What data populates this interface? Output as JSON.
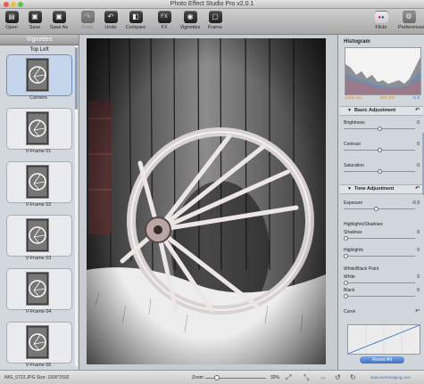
{
  "window": {
    "title": "Photo Effect Studio Pro v2.0.1"
  },
  "toolbar": {
    "items": [
      {
        "label": "Open",
        "glyph": "▤"
      },
      {
        "label": "Save",
        "glyph": "▣"
      },
      {
        "label": "Save As",
        "glyph": "▣"
      },
      {
        "label": "Redo",
        "glyph": "↷"
      },
      {
        "label": "Undo",
        "glyph": "↶"
      },
      {
        "label": "Compare",
        "glyph": "◧"
      },
      {
        "label": "FX",
        "glyph": "FX"
      },
      {
        "label": "Vignettes",
        "glyph": "◉"
      },
      {
        "label": "Frame",
        "glyph": "▢"
      },
      {
        "label": "Flickr",
        "glyph": "●●"
      },
      {
        "label": "Preferences",
        "glyph": "⚙"
      }
    ]
  },
  "left_panel": {
    "title": "Vignettes",
    "section": "Top Left",
    "items": [
      {
        "label": "Corners",
        "selected": true
      },
      {
        "label": "V-Frame 01"
      },
      {
        "label": "V-Frame 02"
      },
      {
        "label": "V-Frame 03"
      },
      {
        "label": "V-Frame 04"
      },
      {
        "label": "V-Frame 05"
      }
    ]
  },
  "histogram": {
    "title": "Histogram",
    "exif": [
      "1/100 sec",
      "ISO 200",
      "f1.8"
    ]
  },
  "basic_adjustment": {
    "title": "Basic Adjustment",
    "controls": [
      {
        "name": "Brightness",
        "value": "0",
        "level": 0.5
      },
      {
        "name": "Contrast",
        "value": "0",
        "level": 0.5
      },
      {
        "name": "Saturation",
        "value": "0",
        "level": 0.5
      }
    ]
  },
  "tone_adjustment": {
    "title": "Tone Adjustment",
    "exposure": {
      "name": "Exposure",
      "value": "-0.9",
      "level": 0.46
    },
    "highlights_shadows": {
      "name": "Highlights/Shadows",
      "shadows": "Shadows",
      "shadows_value": "0",
      "highlights": "Highlights",
      "highlights_value": "0"
    },
    "white_black": {
      "name": "White/Black Point",
      "white": "White",
      "white_value": "0",
      "black": "Black",
      "black_value": "0"
    }
  },
  "curve": {
    "name": "Curve"
  },
  "reset_all": "Reset All",
  "statusbar": {
    "file": "IMG_0722.JPG   Size: 1936*2592",
    "zoom_label": "Zoom",
    "zoom_value": "32%",
    "website": "www.everimaging.com"
  },
  "colors": {
    "accent": "#3f72c4",
    "selected_thumb": "#c4d5ec"
  }
}
